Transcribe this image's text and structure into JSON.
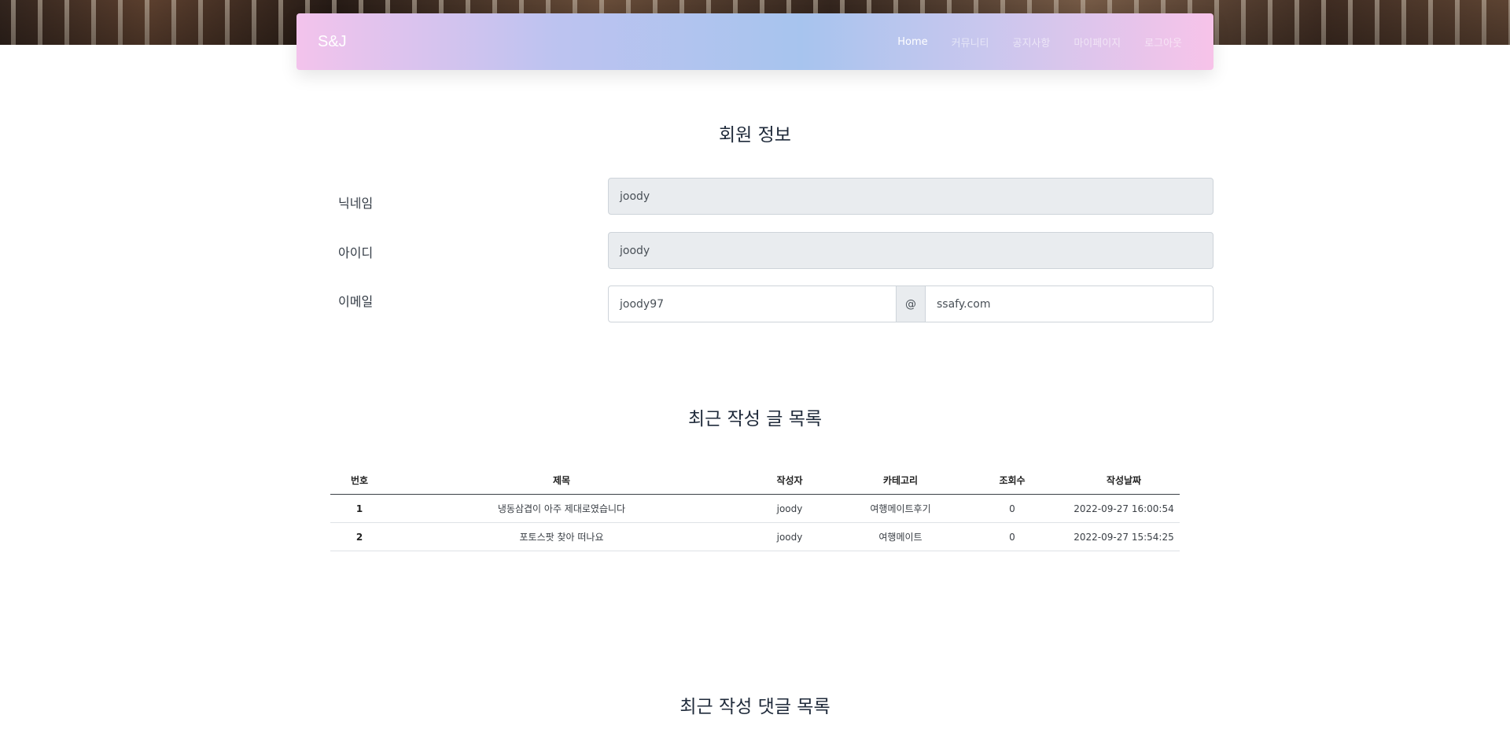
{
  "navbar": {
    "brand": "S&J",
    "links": [
      "Home",
      "커뮤니티",
      "공지사항",
      "마이페이지",
      "로그아웃"
    ]
  },
  "profile": {
    "title": "회원 정보",
    "nickname_label": "닉네임",
    "nickname_value": "joody",
    "id_label": "아이디",
    "id_value": "joody",
    "email_label": "이메일",
    "email_local": "joody97",
    "email_at": "@",
    "email_domain": "ssafy.com"
  },
  "posts": {
    "title": "최근 작성 글 목록",
    "columns": [
      "번호",
      "제목",
      "작성자",
      "카테고리",
      "조회수",
      "작성날짜"
    ],
    "rows": [
      [
        "1",
        "냉동삼겹이 아주 제대로였습니다",
        "joody",
        "여행메이트후기",
        "0",
        "2022-09-27 16:00:54"
      ],
      [
        "2",
        "포토스팟 찾아 떠나요",
        "joody",
        "여행메이트",
        "0",
        "2022-09-27 15:54:25"
      ]
    ]
  },
  "comments": {
    "title": "최근 작성 댓글 목록"
  }
}
